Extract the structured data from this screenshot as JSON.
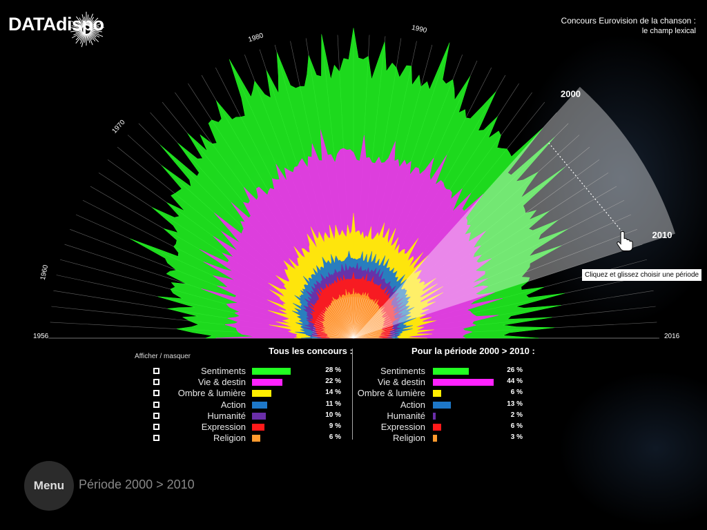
{
  "brand": {
    "logo_text": "DATAdispo"
  },
  "header": {
    "title": "Concours Eurovision de la chanson :",
    "subtitle": "le champ lexical"
  },
  "chart_data": {
    "type": "area",
    "layout": "radial-fan",
    "x_start_label": "1956",
    "x_end_label": "2016",
    "decade_labels": [
      "1960",
      "1970",
      "1980",
      "1990",
      "2000",
      "2010"
    ],
    "selection": {
      "start": "2000",
      "end": "2010"
    },
    "series": [
      {
        "name": "Sentiments",
        "color": "#22ff22"
      },
      {
        "name": "Vie & destin",
        "color": "#ff22ff"
      },
      {
        "name": "Ombre & lumière",
        "color": "#ffee00"
      },
      {
        "name": "Action",
        "color": "#1e78c8"
      },
      {
        "name": "Humanité",
        "color": "#6a2ea8"
      },
      {
        "name": "Expression",
        "color": "#ff1a1a"
      },
      {
        "name": "Religion",
        "color": "#ff9a2e"
      }
    ]
  },
  "tooltip": "Cliquez et glissez choisir une période",
  "toggle_label": "Afficher / masquer",
  "all_contests": {
    "title": "Tous les concours :",
    "rows": [
      {
        "label": "Sentiments",
        "value": 28,
        "pct": "28 %"
      },
      {
        "label": "Vie & destin",
        "value": 22,
        "pct": "22 %"
      },
      {
        "label": "Ombre & lumière",
        "value": 14,
        "pct": "14 %"
      },
      {
        "label": "Action",
        "value": 11,
        "pct": "11 %"
      },
      {
        "label": "Humanité",
        "value": 10,
        "pct": "10 %"
      },
      {
        "label": "Expression",
        "value": 9,
        "pct": "9 %"
      },
      {
        "label": "Religion",
        "value": 6,
        "pct": "6 %"
      }
    ]
  },
  "period": {
    "title": "Pour la période 2000 > 2010 :",
    "rows": [
      {
        "label": "Sentiments",
        "value": 26,
        "pct": "26 %"
      },
      {
        "label": "Vie & destin",
        "value": 44,
        "pct": "44 %"
      },
      {
        "label": "Ombre & lumière",
        "value": 6,
        "pct": "6 %"
      },
      {
        "label": "Action",
        "value": 13,
        "pct": "13 %"
      },
      {
        "label": "Humanité",
        "value": 2,
        "pct": "2 %"
      },
      {
        "label": "Expression",
        "value": 6,
        "pct": "6 %"
      },
      {
        "label": "Religion",
        "value": 3,
        "pct": "3 %"
      }
    ]
  },
  "menu": {
    "label": "Menu"
  },
  "period_label": "Période 2000 > 2010"
}
